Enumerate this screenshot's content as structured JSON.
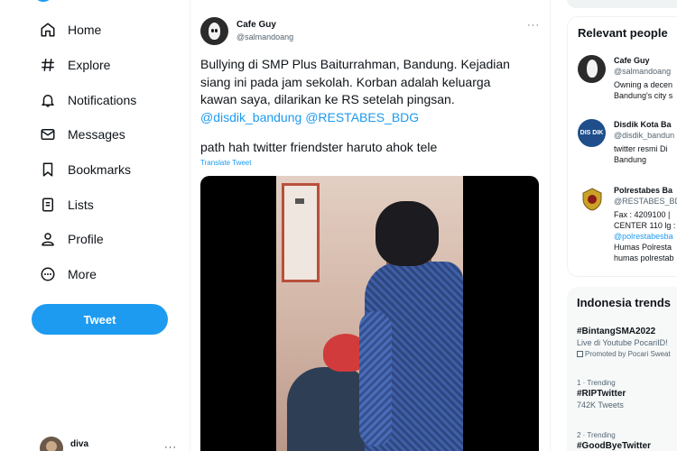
{
  "nav": {
    "items": [
      {
        "label": "Home",
        "icon": "home-icon"
      },
      {
        "label": "Explore",
        "icon": "hashtag-icon"
      },
      {
        "label": "Notifications",
        "icon": "bell-icon"
      },
      {
        "label": "Messages",
        "icon": "envelope-icon"
      },
      {
        "label": "Bookmarks",
        "icon": "bookmark-icon"
      },
      {
        "label": "Lists",
        "icon": "list-icon"
      },
      {
        "label": "Profile",
        "icon": "person-icon"
      },
      {
        "label": "More",
        "icon": "more-circle-icon"
      }
    ],
    "tweet_button": "Tweet",
    "account_name": "diva",
    "account_more": "···"
  },
  "tweet": {
    "author_name": "Cafe Guy",
    "author_handle": "@salmandoang",
    "more": "···",
    "text_line1": "Bullying di SMP Plus Baiturrahman, Bandung. Kejadian",
    "text_line2": "siang ini pada jam sekolah. Korban adalah keluarga",
    "text_line3": "kawan saya, dilarikan ke RS setelah pingsan.",
    "mention1": "@disdik_bandung",
    "mention2": "@RESTABES_BDG",
    "text_line4": "path hah twitter friendster haruto ahok tele",
    "translate": "Translate Tweet"
  },
  "relevant": {
    "title": "Relevant people",
    "people": [
      {
        "name": "Cafe Guy",
        "handle": "@salmandoang",
        "bio1": "Owning a decen",
        "bio2": "Bandung's city s",
        "bio3": ""
      },
      {
        "name": "Disdik Kota Ba",
        "handle": "@disdik_bandun",
        "bio1": "twitter resmi Di",
        "bio2": "Bandung",
        "bio3": ""
      },
      {
        "name": "Polrestabes Ba",
        "handle": "@RESTABES_BD",
        "bio1": "Fax : 4209100 |",
        "bio2": "CENTER 110 lg :",
        "bio3": "@polrestabesba",
        "bio4": "Humas Polresta",
        "bio5": "humas polrestab"
      }
    ],
    "disdik_logo_text": "DIS DIK"
  },
  "trends": {
    "title": "Indonesia trends",
    "items": [
      {
        "meta": "",
        "name": "#BintangSMA2022",
        "sub": "Live di Youtube PocariID!",
        "promo": "Promoted by Pocari Sweat"
      },
      {
        "meta": "1 · Trending",
        "name": "#RIPTwitter",
        "sub": "742K Tweets",
        "promo": ""
      },
      {
        "meta": "2 · Trending",
        "name": "#GoodByeTwitter",
        "sub": "",
        "promo": ""
      }
    ]
  },
  "colors": {
    "accent": "#1d9bf0",
    "text": "#0f1419",
    "muted": "#536471"
  }
}
